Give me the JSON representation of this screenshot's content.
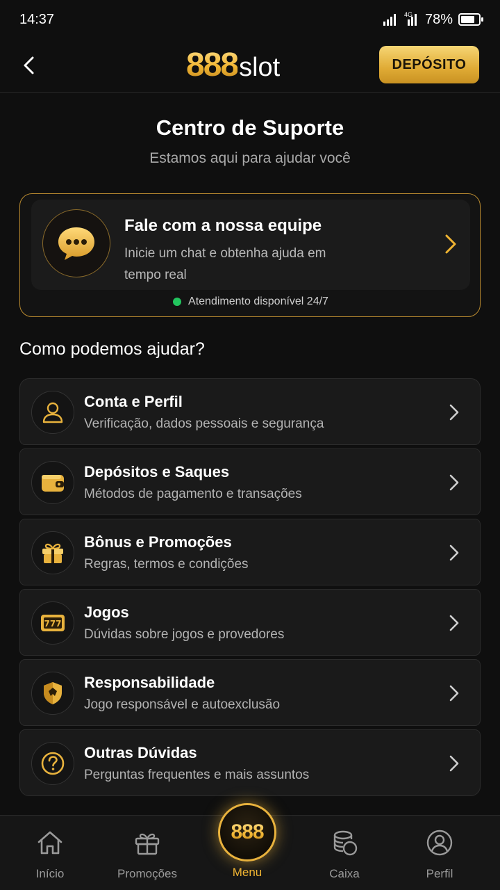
{
  "status_bar": {
    "time": "14:37",
    "network": "4G",
    "battery": "78%",
    "battery_level": 0.78
  },
  "header": {
    "logo_number": "888",
    "logo_text": "slot",
    "deposit_label": "DEPÓSITO"
  },
  "page": {
    "title": "Centro de Suporte",
    "subtitle": "Estamos aqui para ajudar você"
  },
  "chat_card": {
    "title": "Fale com a nossa equipe",
    "description": "Inicie um chat e obtenha ajuda em tempo real",
    "status": "Atendimento disponível 24/7"
  },
  "help_section": {
    "title": "Como podemos ajudar?",
    "items": [
      {
        "title": "Conta e Perfil",
        "description": "Verificação, dados pessoais e segurança",
        "icon": "user-icon"
      },
      {
        "title": "Depósitos e Saques",
        "description": "Métodos de pagamento e transações",
        "icon": "wallet-icon"
      },
      {
        "title": "Bônus e Promoções",
        "description": "Regras, termos e condições",
        "icon": "gift-icon"
      },
      {
        "title": "Jogos",
        "description": "Dúvidas sobre jogos e provedores",
        "icon": "slot-machine-icon"
      },
      {
        "title": "Responsabilidade",
        "description": "Jogo responsável e autoexclusão",
        "icon": "shield-icon"
      },
      {
        "title": "Outras Dúvidas",
        "description": "Perguntas frequentes e mais assuntos",
        "icon": "question-icon"
      }
    ]
  },
  "bottom_nav": {
    "items": [
      {
        "label": "Início",
        "icon": "home-icon"
      },
      {
        "label": "Promoções",
        "icon": "gift-icon"
      },
      {
        "label": "Menu",
        "icon": "888-logo-icon",
        "active": true
      },
      {
        "label": "Caixa",
        "icon": "coins-icon"
      },
      {
        "label": "Perfil",
        "icon": "profile-icon"
      }
    ],
    "center_logo": "888"
  },
  "colors": {
    "accent": "#f0b432",
    "background": "#0f0f0f",
    "card": "#1a1a1a",
    "online": "#22c55e"
  }
}
